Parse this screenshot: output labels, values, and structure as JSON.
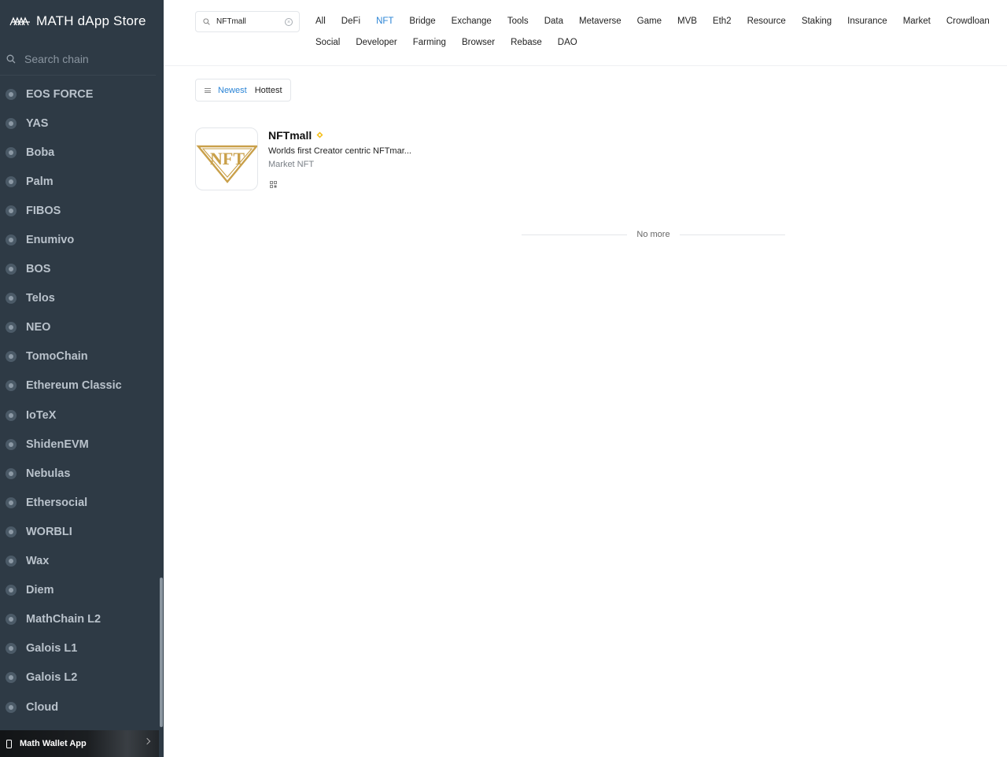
{
  "sidebar": {
    "title": "MATH dApp Store",
    "search_placeholder": "Search chain",
    "chains": [
      {
        "label": "EOS FORCE",
        "icon": "eos-force-icon"
      },
      {
        "label": "YAS",
        "icon": "yas-icon"
      },
      {
        "label": "Boba",
        "icon": "boba-icon"
      },
      {
        "label": "Palm",
        "icon": "palm-icon"
      },
      {
        "label": "FIBOS",
        "icon": "fibos-icon"
      },
      {
        "label": "Enumivo",
        "icon": "enumivo-icon"
      },
      {
        "label": "BOS",
        "icon": "bos-icon"
      },
      {
        "label": "Telos",
        "icon": "telos-icon"
      },
      {
        "label": "NEO",
        "icon": "neo-icon"
      },
      {
        "label": "TomoChain",
        "icon": "tomochain-icon"
      },
      {
        "label": "Ethereum Classic",
        "icon": "ethereum-classic-icon"
      },
      {
        "label": "IoTeX",
        "icon": "iotex-icon"
      },
      {
        "label": "ShidenEVM",
        "icon": "shidenevm-icon"
      },
      {
        "label": "Nebulas",
        "icon": "nebulas-icon"
      },
      {
        "label": "Ethersocial",
        "icon": "ethersocial-icon"
      },
      {
        "label": "WORBLI",
        "icon": "worbli-icon"
      },
      {
        "label": "Wax",
        "icon": "wax-icon"
      },
      {
        "label": "Diem",
        "icon": "diem-icon"
      },
      {
        "label": "MathChain L2",
        "icon": "mathchain-l2-icon"
      },
      {
        "label": "Galois L1",
        "icon": "galois-l1-icon"
      },
      {
        "label": "Galois L2",
        "icon": "galois-l2-icon"
      },
      {
        "label": "Cloud",
        "icon": "cloud-icon"
      }
    ],
    "wallet_app": "Math Wallet App"
  },
  "topbar": {
    "search_value": "NFTmall",
    "tabs": [
      "All",
      "DeFi",
      "NFT",
      "Bridge",
      "Exchange",
      "Tools",
      "Data",
      "Metaverse",
      "Game",
      "MVB",
      "Eth2",
      "Resource",
      "Staking",
      "Insurance",
      "Market",
      "Crowdloan",
      "Social",
      "Developer",
      "Farming",
      "Browser",
      "Rebase",
      "DAO"
    ],
    "active_tab": "NFT"
  },
  "sort": {
    "newest": "Newest",
    "hottest": "Hottest",
    "active": "Newest"
  },
  "results": [
    {
      "name": "NFTmall",
      "description": "Worlds first Creator centric NFTmar...",
      "tags": "Market NFT",
      "logo_text": "NFT"
    }
  ],
  "footer_text": "No more",
  "colors": {
    "accent": "#2a84d6",
    "sidebar_bg": "#2e3a45",
    "logo_gold": "#c9a04a"
  }
}
